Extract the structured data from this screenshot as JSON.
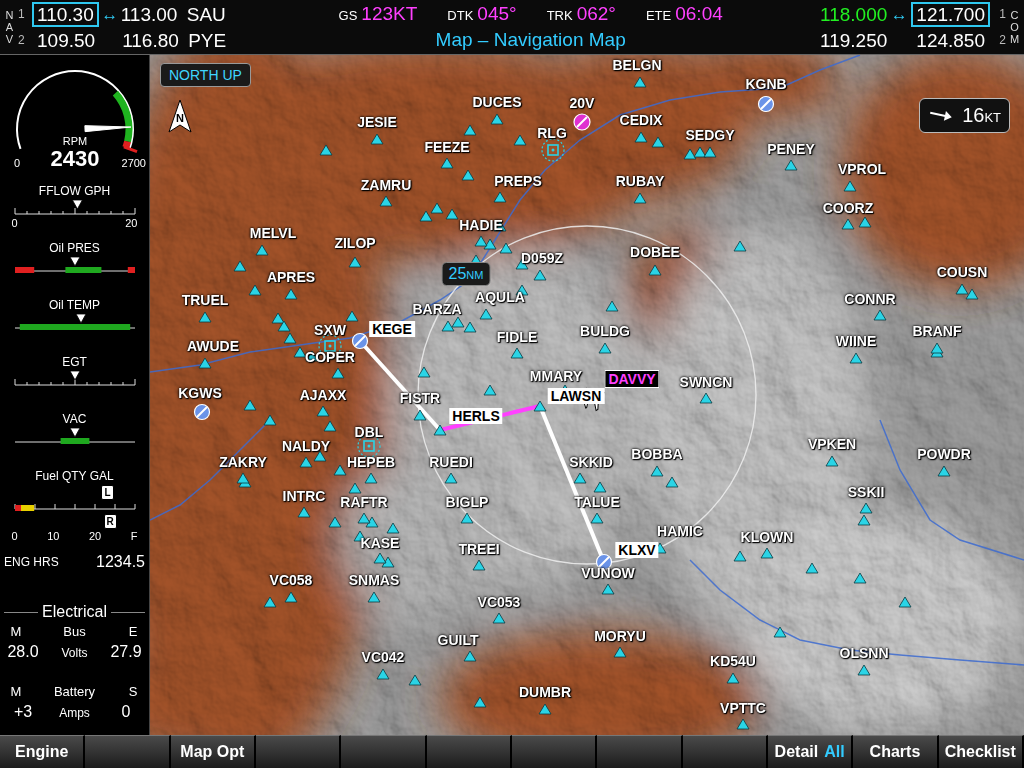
{
  "nav": {
    "label": "NAV",
    "swap": "↔",
    "radios": [
      {
        "index": "1",
        "left": "110.30",
        "right": "113.00",
        "ident": "SAU",
        "selected": true
      },
      {
        "index": "2",
        "left": "109.50",
        "right": "116.80",
        "ident": "PYE",
        "selected": false
      }
    ]
  },
  "flight_data": [
    {
      "label": "GS",
      "value": "123KT"
    },
    {
      "label": "DTK",
      "value": "045°"
    },
    {
      "label": "TRK",
      "value": "062°"
    },
    {
      "label": "ETE",
      "value": "06:04"
    }
  ],
  "page_title": "Map – Navigation Map",
  "com": {
    "label": "COM",
    "swap": "↔",
    "radios": [
      {
        "index": "1",
        "active": "118.000",
        "standby": "121.700",
        "selected": true
      },
      {
        "index": "2",
        "active": "119.250",
        "standby": "124.850",
        "selected": false
      }
    ]
  },
  "engine": {
    "rpm": {
      "label": "RPM",
      "value": "2430",
      "min": "0",
      "max": "2700",
      "level": 0.9,
      "bands": [
        {
          "from": 0.72,
          "to": 0.97,
          "color": "#1fb31f"
        },
        {
          "from": 0.97,
          "to": 1,
          "color": "#e02020"
        }
      ]
    },
    "bars": [
      {
        "label": "FFLOW GPH",
        "kind": "scale",
        "level": 0.52,
        "bands": [],
        "scale": [
          "0",
          "20"
        ]
      },
      {
        "label": "Oil PRES",
        "kind": "band",
        "level": 0.5,
        "bands": [
          {
            "from": 0,
            "to": 0.16,
            "color": "#e02020"
          },
          {
            "from": 0.42,
            "to": 0.72,
            "color": "#1fa81f"
          },
          {
            "from": 0.94,
            "to": 1,
            "color": "#e02020"
          }
        ],
        "scale": []
      },
      {
        "label": "Oil TEMP",
        "kind": "band",
        "level": 0.55,
        "bands": [
          {
            "from": 0.04,
            "to": 0.96,
            "color": "#1fa81f"
          }
        ],
        "scale": []
      },
      {
        "label": "EGT",
        "kind": "scale",
        "level": 0.5,
        "bands": [],
        "scale": []
      },
      {
        "label": "VAC",
        "kind": "band",
        "level": 0.5,
        "bands": [
          {
            "from": 0.38,
            "to": 0.62,
            "color": "#1fa81f"
          }
        ],
        "scale": []
      }
    ],
    "fuel": {
      "label": "Fuel QTY GAL",
      "bands": [
        {
          "from": 0,
          "to": 0.05,
          "color": "#e02020"
        },
        {
          "from": 0.05,
          "to": 0.16,
          "color": "#e8d000"
        }
      ],
      "markers": [
        {
          "label": "L",
          "level": 0.78
        },
        {
          "label": "R",
          "level": 0.8
        }
      ],
      "scale": [
        "0",
        "10",
        "20",
        "F"
      ]
    },
    "eng_hrs": {
      "label": "ENG HRS",
      "value": "1234.5"
    },
    "electrical": {
      "title": "Electrical",
      "groups": [
        {
          "left": "M",
          "name": "Bus",
          "right": "E",
          "left_value": "28.0",
          "unit": "Volts",
          "right_value": "27.9"
        },
        {
          "left": "M",
          "name": "Battery",
          "right": "S",
          "left_value": "+3",
          "unit": "Amps",
          "right_value": "0"
        }
      ]
    }
  },
  "map": {
    "orientation": "NORTH UP",
    "north": "N",
    "range": {
      "value": "25",
      "unit": "NM"
    },
    "wind": {
      "speed": "16",
      "unit": "KT"
    },
    "waypoints": [
      {
        "name": "BELGN",
        "kind": "intersection",
        "style": "plain"
      },
      {
        "name": "DUCES",
        "kind": "intersection",
        "style": "plain"
      },
      {
        "name": "JESIE",
        "kind": "intersection",
        "style": "plain"
      },
      {
        "name": "FEEZE",
        "kind": "intersection",
        "style": "plain"
      },
      {
        "name": "20V",
        "kind": "nontowered",
        "style": "plain"
      },
      {
        "name": "RLG",
        "kind": "vor",
        "style": "plain"
      },
      {
        "name": "CEDIX",
        "kind": "intersection",
        "style": "plain"
      },
      {
        "name": "KGNB",
        "kind": "towered",
        "style": "plain"
      },
      {
        "name": "SEDGY",
        "kind": "intersection",
        "style": "plain"
      },
      {
        "name": "PENEY",
        "kind": "intersection",
        "style": "plain"
      },
      {
        "name": "VPROL",
        "kind": "intersection",
        "style": "plain"
      },
      {
        "name": "COORZ",
        "kind": "intersection",
        "style": "plain"
      },
      {
        "name": "ZAMRU",
        "kind": "intersection",
        "style": "plain"
      },
      {
        "name": "PREPS",
        "kind": "intersection",
        "style": "plain"
      },
      {
        "name": "RUBAY",
        "kind": "intersection",
        "style": "plain"
      },
      {
        "name": "HADIE",
        "kind": "intersection",
        "style": "plain"
      },
      {
        "name": "MELVL",
        "kind": "intersection",
        "style": "plain"
      },
      {
        "name": "ZILOP",
        "kind": "intersection",
        "style": "plain"
      },
      {
        "name": "D059Z",
        "kind": "intersection",
        "style": "plain"
      },
      {
        "name": "DOBEE",
        "kind": "intersection",
        "style": "plain"
      },
      {
        "name": "COUSN",
        "kind": "intersection",
        "style": "plain"
      },
      {
        "name": "APRES",
        "kind": "intersection",
        "style": "plain"
      },
      {
        "name": "AQULA",
        "kind": "intersection",
        "style": "plain"
      },
      {
        "name": "CONNR",
        "kind": "intersection",
        "style": "plain"
      },
      {
        "name": "TRUEL",
        "kind": "intersection",
        "style": "plain"
      },
      {
        "name": "BARZA",
        "kind": "intersection",
        "style": "plain"
      },
      {
        "name": "KEGE",
        "kind": "towered",
        "style": "route"
      },
      {
        "name": "SXW",
        "kind": "vor",
        "style": "plain"
      },
      {
        "name": "COPER",
        "kind": "intersection",
        "style": "plain"
      },
      {
        "name": "FIDLE",
        "kind": "intersection",
        "style": "plain"
      },
      {
        "name": "BULDG",
        "kind": "intersection",
        "style": "plain"
      },
      {
        "name": "WIINE",
        "kind": "intersection",
        "style": "plain"
      },
      {
        "name": "BRANF",
        "kind": "intersection",
        "style": "plain"
      },
      {
        "name": "AWUDE",
        "kind": "intersection",
        "style": "plain"
      },
      {
        "name": "MMARY",
        "kind": "intersection",
        "style": "plain"
      },
      {
        "name": "DAVVY",
        "kind": "intersection",
        "style": "active"
      },
      {
        "name": "LAWSN",
        "kind": "intersection",
        "style": "route"
      },
      {
        "name": "SWNCN",
        "kind": "intersection",
        "style": "plain"
      },
      {
        "name": "FISTR",
        "kind": "intersection",
        "style": "plain"
      },
      {
        "name": "AJAXX",
        "kind": "intersection",
        "style": "plain"
      },
      {
        "name": "KGWS",
        "kind": "towered",
        "style": "plain"
      },
      {
        "name": "HERLS",
        "kind": "intersection",
        "style": "route"
      },
      {
        "name": "DBL",
        "kind": "vor",
        "style": "plain"
      },
      {
        "name": "NALDY",
        "kind": "intersection",
        "style": "plain"
      },
      {
        "name": "VPKEN",
        "kind": "intersection",
        "style": "plain"
      },
      {
        "name": "BOBBA",
        "kind": "intersection",
        "style": "plain"
      },
      {
        "name": "POWDR",
        "kind": "intersection",
        "style": "plain"
      },
      {
        "name": "ZAKRY",
        "kind": "intersection",
        "style": "plain"
      },
      {
        "name": "HEPEB",
        "kind": "intersection",
        "style": "plain"
      },
      {
        "name": "RUEDI",
        "kind": "intersection",
        "style": "plain"
      },
      {
        "name": "SKKID",
        "kind": "intersection",
        "style": "plain"
      },
      {
        "name": "SSKII",
        "kind": "intersection",
        "style": "plain"
      },
      {
        "name": "INTRC",
        "kind": "intersection",
        "style": "plain"
      },
      {
        "name": "RAFTR",
        "kind": "intersection",
        "style": "plain"
      },
      {
        "name": "BIGLP",
        "kind": "intersection",
        "style": "plain"
      },
      {
        "name": "TALUE",
        "kind": "intersection",
        "style": "plain"
      },
      {
        "name": "HAMIC",
        "kind": "intersection",
        "style": "plain"
      },
      {
        "name": "KLOWN",
        "kind": "intersection",
        "style": "plain"
      },
      {
        "name": "KASE",
        "kind": "intersection",
        "style": "plain"
      },
      {
        "name": "TREEI",
        "kind": "intersection",
        "style": "plain"
      },
      {
        "name": "KLXV",
        "kind": "towered",
        "style": "route"
      },
      {
        "name": "VUNOW",
        "kind": "intersection",
        "style": "plain"
      },
      {
        "name": "VC058",
        "kind": "intersection",
        "style": "plain"
      },
      {
        "name": "SNMAS",
        "kind": "intersection",
        "style": "plain"
      },
      {
        "name": "VC053",
        "kind": "intersection",
        "style": "plain"
      },
      {
        "name": "MORYU",
        "kind": "intersection",
        "style": "plain"
      },
      {
        "name": "GUILT",
        "kind": "intersection",
        "style": "plain"
      },
      {
        "name": "OLSNN",
        "kind": "intersection",
        "style": "plain"
      },
      {
        "name": "VC042",
        "kind": "intersection",
        "style": "plain"
      },
      {
        "name": "KD54U",
        "kind": "intersection",
        "style": "plain"
      },
      {
        "name": "DUMBR",
        "kind": "intersection",
        "style": "plain"
      },
      {
        "name": "VPTTC",
        "kind": "intersection",
        "style": "plain"
      }
    ],
    "route": [
      {
        "from": "KEGE",
        "to": "HERLS",
        "active": false
      },
      {
        "from": "HERLS",
        "to": "LAWSN",
        "active": true
      },
      {
        "from": "LAWSN",
        "to": "KLXV",
        "active": false
      }
    ]
  },
  "softkeys": [
    {
      "label": "Engine",
      "value": ""
    },
    {
      "label": "",
      "value": ""
    },
    {
      "label": "Map Opt",
      "value": ""
    },
    {
      "label": "",
      "value": ""
    },
    {
      "label": "",
      "value": ""
    },
    {
      "label": "",
      "value": ""
    },
    {
      "label": "",
      "value": ""
    },
    {
      "label": "",
      "value": ""
    },
    {
      "label": "",
      "value": ""
    },
    {
      "label": "Detail",
      "value": "All"
    },
    {
      "label": "Charts",
      "value": ""
    },
    {
      "label": "Checklist",
      "value": ""
    }
  ]
}
